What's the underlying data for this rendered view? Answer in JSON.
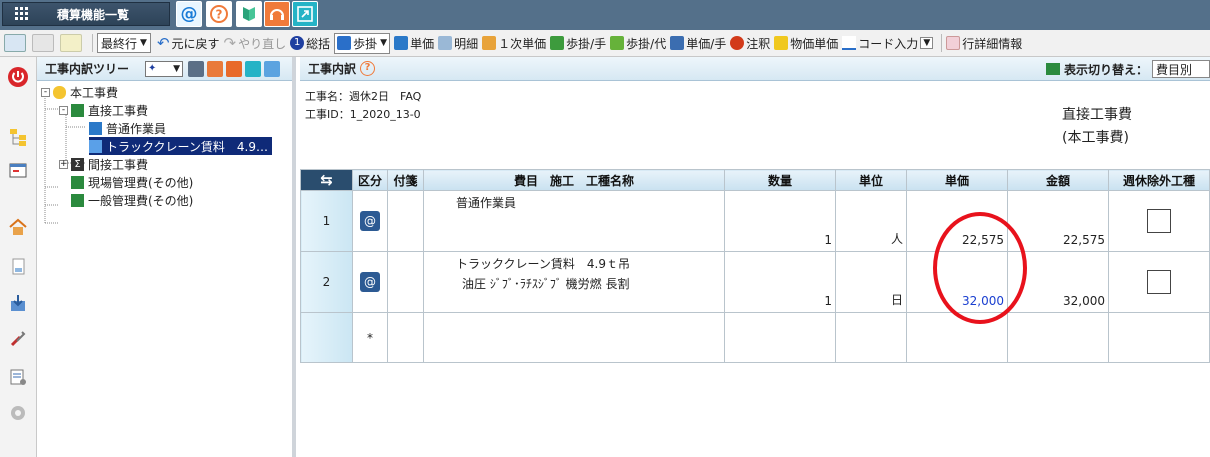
{
  "app": {
    "menu_label": "積算機能一覧"
  },
  "toolbar": {
    "mode_select": "最終行",
    "undo": "元に戻す",
    "redo": "やり直し",
    "total": "総括",
    "ratio": "歩掛",
    "unit_price": "単価",
    "detail": "明細",
    "primary_unit_price": "１次単価",
    "ratio_hand": "歩掛/手",
    "ratio_sub": "歩掛/代",
    "unit_price_hand": "単価/手",
    "note": "注釈",
    "material_unit_price": "物価単価",
    "code_input": "コード入力",
    "row_detail": "行詳細情報"
  },
  "tree": {
    "title": "工事内訳ツリー",
    "nodes": [
      {
        "label": "本工事費"
      },
      {
        "label": "直接工事費"
      },
      {
        "label": "普通作業員"
      },
      {
        "label": "トラッククレーン賃料　4.9…"
      },
      {
        "label": "間接工事費"
      },
      {
        "label": "現場管理費(その他)"
      },
      {
        "label": "一般管理費(その他)"
      }
    ]
  },
  "main": {
    "title": "工事内訳",
    "view_switch_label": "表示切り替え：",
    "view_switch_value": "費目別",
    "project_name": "工事名：週休2日　FAQ",
    "project_id": "工事ID：1_2020_13-0",
    "heading_line1": "直接工事費",
    "heading_line2": "(本工事費)",
    "columns": [
      "区分",
      "付箋",
      "費目　施工　工種名称",
      "数量",
      "単位",
      "単価",
      "金額",
      "週休除外工種"
    ],
    "rows": [
      {
        "no": "1",
        "name1": "普通作業員",
        "name2": "",
        "qty": "1",
        "unit": "人",
        "price": "22,575",
        "amount": "22,575"
      },
      {
        "no": "2",
        "name1": "トラッククレーン賃料　4.9ｔ吊",
        "name2": "油圧 ｼﾞﾌﾞ･ﾗﾁｽｼﾞﾌﾞ 機労燃 長割",
        "qty": "1",
        "unit": "日",
        "price": "32,000",
        "amount": "32,000"
      }
    ],
    "new_row_marker": "*"
  },
  "colors": {
    "topbar": "#54708a",
    "highlight_circle": "#e8121c",
    "selected_tree": "#0f2a78",
    "price_blue": "#1a3fd0"
  }
}
